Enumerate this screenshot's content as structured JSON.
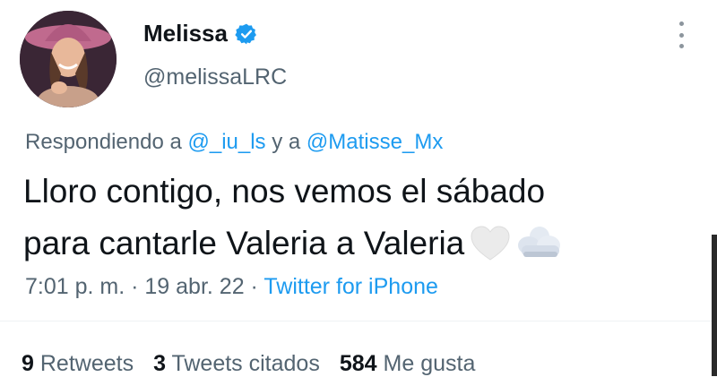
{
  "author": {
    "name": "Melissa",
    "handle": "@melissaLRC",
    "verified": true,
    "avatar_alt": "profile photo"
  },
  "reply_context": {
    "prefix": "Respondiendo a ",
    "mention1": "@_iu_ls",
    "connector": " y a ",
    "mention2": "@Matisse_Mx"
  },
  "tweet": {
    "line1": "Lloro contigo, nos vemos el sábado",
    "line2": "para cantarle Valeria a Valeria",
    "emojis": [
      "white-heart-icon",
      "cloud-icon"
    ]
  },
  "meta": {
    "time": "7:01 p. m.",
    "separator": " · ",
    "date": "19 abr. 22",
    "source": "Twitter for iPhone"
  },
  "stats": {
    "retweets_count": "9",
    "retweets_label": "Retweets",
    "quotes_count": "3",
    "quotes_label": "Tweets citados",
    "likes_count": "584",
    "likes_label": "Me gusta"
  },
  "colors": {
    "link": "#1d9bf0",
    "secondary_text": "#536471",
    "primary_text": "#0f1419"
  }
}
